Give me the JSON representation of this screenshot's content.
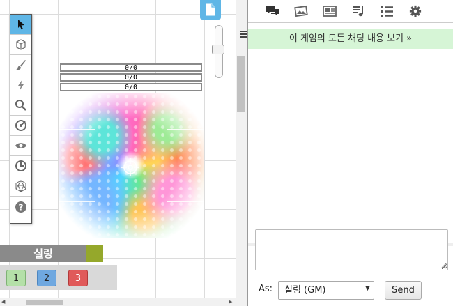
{
  "token": {
    "bars": [
      "0/0",
      "0/0",
      "0/0"
    ],
    "name": "실링"
  },
  "macros": [
    {
      "label": "1",
      "color": "#b4e0a8"
    },
    {
      "label": "2",
      "color": "#6fa8e0"
    },
    {
      "label": "3",
      "color": "#e05a5a"
    }
  ],
  "toolbar": {
    "tools": [
      "select-arrow-icon",
      "cube-icon",
      "brush-icon",
      "lightning-icon",
      "magnifier-icon",
      "dice-target-icon",
      "eye-icon",
      "clock-icon",
      "d20-icon",
      "help-icon"
    ],
    "active_tool": "select-arrow-icon",
    "accent": "#5fb6e6"
  },
  "sidebar": {
    "tabs": [
      "chat-bubbles-icon",
      "art-library-icon",
      "journal-icon",
      "jukebox-icon",
      "compendium-list-icon",
      "settings-gear-icon"
    ],
    "archive_link": "이 게임의 모든 채팅 내용 보기 »",
    "as_label": "As:",
    "as_value": "실링 (GM)",
    "send_label": "Send"
  }
}
